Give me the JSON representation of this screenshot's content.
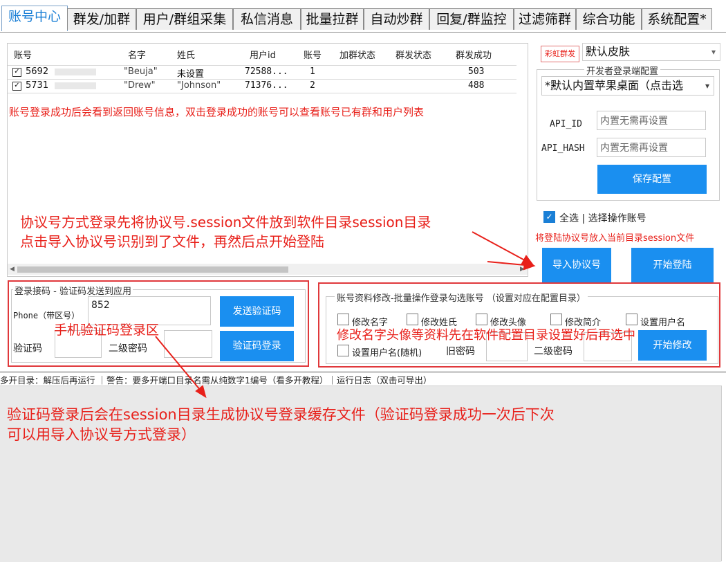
{
  "tabs": [
    {
      "label": "账号中心"
    },
    {
      "label": "群发/加群"
    },
    {
      "label": "用户/群组采集"
    },
    {
      "label": "私信消息"
    },
    {
      "label": "批量拉群"
    },
    {
      "label": "自动炒群"
    },
    {
      "label": "回复/群监控"
    },
    {
      "label": "过滤筛群"
    },
    {
      "label": "综合功能"
    },
    {
      "label": "系统配置*"
    }
  ],
  "grid": {
    "headers": [
      "账号",
      "名字",
      "姓氏",
      "用户id",
      "账号",
      "加群状态",
      "群发状态",
      "群发成功"
    ],
    "rows": [
      {
        "phone": "5692",
        "first": "\"Beuja\"",
        "last": "未设置",
        "uid": "72588...",
        "idx": "1",
        "success": "503"
      },
      {
        "phone": "5731",
        "first": "\"Drew\"",
        "last": "\"Johnson\"",
        "uid": "71376...",
        "idx": "2",
        "success": "488"
      }
    ],
    "note": "账号登录成功后会看到返回账号信息，双击登录成功的账号可以查看账号已有群和用户列表"
  },
  "annotations": {
    "session_line1": "协议号方式登录先将协议号.session文件放到软件目录session目录",
    "session_line2": "点击导入协议号识别到了文件，再然后点开始登陆",
    "phone_area": "手机验证码登录区",
    "profile_hint": "修改名字头像等资料先在软件配置目录设置好后再选中",
    "bottom_line1": "验证码登录后会在session目录生成协议号登录缓存文件（验证码登录成功一次后下次",
    "bottom_line2": "可以用导入协议号方式登录）"
  },
  "skin": {
    "badge": "彩虹群发",
    "value": "默认皮肤"
  },
  "dev_config": {
    "title": "开发者登录端配置",
    "device": "*默认内置苹果桌面（点击选",
    "api_id_label": "API_ID",
    "api_hash_label": "API_HASH",
    "api_id_placeholder": "内置无需再设置",
    "api_hash_placeholder": "内置无需再设置",
    "save_label": "保存配置"
  },
  "select_all": {
    "label": "全选 | 选择操作账号"
  },
  "import_hint": "将登陆协议号放入当前目录session文件",
  "actions": {
    "import_label": "导入协议号",
    "start_label": "开始登陆"
  },
  "login": {
    "title": "登录接码 - 验证码发送到应用",
    "phone_label": "Phone（带区号）",
    "phone_value": "852",
    "code_label": "验证码",
    "pwd2_label": "二级密码",
    "send_label": "发送验证码",
    "login_label": "验证码登录"
  },
  "profile": {
    "title": "账号资料修改-批量操作登录勾选账号 （设置对应在配置目录）",
    "options": [
      "修改名字",
      "修改姓氏",
      "修改头像",
      "修改简介",
      "设置用户名"
    ],
    "random_username": "设置用户名(随机)",
    "old_pwd_label": "旧密码",
    "pwd2_label": "二级密码",
    "start_label": "开始修改"
  },
  "status_bar": "多开目录：解压后再运行 ｜警告：要多开端口目录名需从纯数字1编号（看多开教程）｜运行日志（双击可导出）"
}
